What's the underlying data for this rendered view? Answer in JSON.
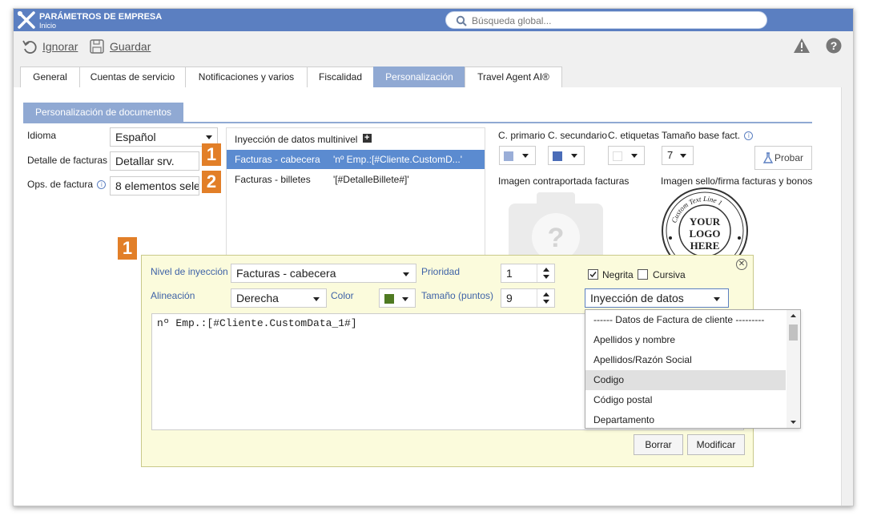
{
  "window": {
    "title": "PARÁMETROS DE EMPRESA",
    "subtitle": "Inicio",
    "search_placeholder": "Búsqueda global..."
  },
  "toolbar": {
    "ignore_label": "Ignorar",
    "save_label": "Guardar"
  },
  "tabs": [
    {
      "label": "General"
    },
    {
      "label": "Cuentas de servicio"
    },
    {
      "label": "Notificaciones y varios"
    },
    {
      "label": "Fiscalidad"
    },
    {
      "label": "Personalización",
      "active": true
    },
    {
      "label": "Travel Agent AI®"
    }
  ],
  "section": {
    "title": "Personalización de documentos"
  },
  "form": {
    "idioma_label": "Idioma",
    "idioma_value": "Español",
    "detalle_label": "Detalle de facturas",
    "detalle_value": "Detallar srv.",
    "ops_label": "Ops. de factura",
    "ops_value": "8 elementos sele"
  },
  "injection": {
    "header": "Inyección de datos multinivel",
    "rows": [
      {
        "name": "Facturas - cabecera",
        "value": "'nº Emp.:[#Cliente.CustomD...'",
        "badge": "1"
      },
      {
        "name": "Facturas - billetes",
        "value": "'[#DetalleBillete#]'",
        "badge": "2"
      }
    ]
  },
  "colors": {
    "primary_label": "C. primario",
    "secondary_label": "C. secundario",
    "labels_label": "C. etiquetas",
    "base_size_label": "Tamaño base fact.",
    "base_size_value": "7",
    "probar_label": "Probar",
    "primary": "#9aaed8",
    "secondary": "#4a6cb8",
    "labels": "#ffffff",
    "accent": "#5b7fc1",
    "badge": "#e27f28"
  },
  "images": {
    "cover_label": "Imagen contraportada facturas",
    "seal_label": "Imagen sello/firma facturas y bonos",
    "seal_top_text": "Custom Text Line 1",
    "seal_center_text": [
      "YOUR",
      "LOGO",
      "HERE"
    ]
  },
  "dialog": {
    "badge": "1",
    "level_label": "Nivel de inyección",
    "level_value": "Facturas - cabecera",
    "priority_label": "Prioridad",
    "priority_value": "1",
    "bold_label": "Negrita",
    "italic_label": "Cursiva",
    "align_label": "Alineación",
    "align_value": "Derecha",
    "color_label": "Color",
    "color_value": "#4f7a22",
    "size_label": "Tamaño (puntos)",
    "size_value": "9",
    "injection_select": "Inyección de datos",
    "editor_text": "nº Emp.:[#Cliente.CustomData_1#]",
    "delete_label": "Borrar",
    "modify_label": "Modificar"
  },
  "dropdown": {
    "items": [
      "------ Datos de Factura de cliente ---------",
      "Apellidos y nombre",
      "Apellidos/Razón Social",
      "Codigo",
      "Código postal",
      "Departamento"
    ],
    "highlighted_index": 3
  }
}
